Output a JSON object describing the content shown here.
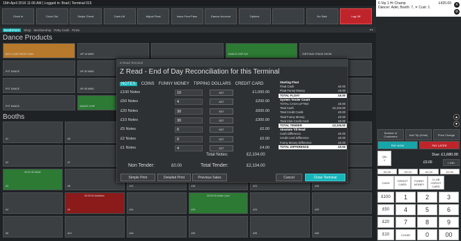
{
  "status": {
    "text": "15th April 2016 11:06 AM | Logged in: Brad | Terminal 015"
  },
  "topbar": [
    "Clock In",
    "Clock Out",
    "Swipe Check",
    "Cash Lift",
    "Adjust Float",
    "Issue Free Pass",
    "Dancer Account",
    "Options",
    "",
    "No Sale",
    "Log Off"
  ],
  "tabs": [
    "BoothPoint",
    "Shop",
    "Membership",
    "Petty Cash",
    "Fines"
  ],
  "tab_arrows": "◂ ▸",
  "sections": {
    "dance": "Dance Products",
    "booths": "Booths"
  },
  "dance_tiles": [
    {
      "label": "BUY CLUB CREDIT £460",
      "style": "orange"
    },
    {
      "label": "VIP 15 MINS",
      "style": ""
    },
    {
      "label": "",
      "style": ""
    },
    {
      "label": "DANCE CHIP £20",
      "style": "green"
    },
    {
      "label": "BIRTHDAY STAGE SHOW",
      "style": ""
    },
    {
      "label": "PVT DANCE",
      "style": ""
    },
    {
      "label": "VIP 30 MINS",
      "style": ""
    },
    {
      "label": "",
      "style": ""
    },
    {
      "label": "",
      "style": ""
    },
    {
      "label": "",
      "style": ""
    },
    {
      "label": "PVT DANCE",
      "style": ""
    },
    {
      "label": "VIP 45 MINS",
      "style": ""
    },
    {
      "label": "",
      "style": ""
    },
    {
      "label": "",
      "style": ""
    },
    {
      "label": "",
      "style": ""
    },
    {
      "label": "PVT DANCE",
      "style": ""
    },
    {
      "label": "DANCE CHIP",
      "style": "green"
    },
    {
      "label": "",
      "style": ""
    },
    {
      "label": "",
      "style": ""
    },
    {
      "label": "",
      "style": ""
    }
  ],
  "booth_tiles": [
    {
      "label": "#1",
      "style": "",
      "top": ""
    },
    {
      "label": "#6",
      "style": "",
      "top": ""
    },
    {
      "label": "#11",
      "style": "",
      "top": ""
    },
    {
      "label": "#16",
      "style": "",
      "top": ""
    },
    {
      "label": "#21",
      "style": "",
      "top": ""
    },
    {
      "label": "#26",
      "style": "",
      "top": ""
    },
    {
      "label": "#2",
      "style": "",
      "top": ""
    },
    {
      "label": "#7",
      "style": "",
      "top": ""
    },
    {
      "label": "#12",
      "style": "",
      "top": ""
    },
    {
      "label": "#17",
      "style": "",
      "top": ""
    },
    {
      "label": "#22",
      "style": "",
      "top": ""
    },
    {
      "label": "#27",
      "style": "",
      "top": ""
    },
    {
      "label": "#3",
      "style": "green",
      "top": "00:01:32 Abbie"
    },
    {
      "label": "#8",
      "style": "",
      "top": ""
    },
    {
      "label": "#13",
      "style": "",
      "top": ""
    },
    {
      "label": "#18",
      "style": "",
      "top": ""
    },
    {
      "label": "#23",
      "style": "",
      "top": ""
    },
    {
      "label": "#28",
      "style": "",
      "top": ""
    },
    {
      "label": "#4",
      "style": "",
      "top": ""
    },
    {
      "label": "#9",
      "style": "red",
      "top": "00:00:00 Addiction"
    },
    {
      "label": "#14",
      "style": "",
      "top": ""
    },
    {
      "label": "#19",
      "style": "green",
      "top": "00:00:20 Action Lynn"
    },
    {
      "label": "#24",
      "style": "",
      "top": ""
    },
    {
      "label": "#29",
      "style": "",
      "top": ""
    },
    {
      "label": "#5",
      "style": "",
      "top": ""
    },
    {
      "label": "#10",
      "style": "",
      "top": ""
    },
    {
      "label": "#15",
      "style": "",
      "top": ""
    },
    {
      "label": "#20",
      "style": "",
      "top": ""
    },
    {
      "label": "#25",
      "style": "",
      "top": ""
    },
    {
      "label": "#30",
      "style": "",
      "top": ""
    }
  ],
  "modal": {
    "window_title": "Z Read Terminal",
    "title": "Z Read - End of Day Reconciliation for this Terminal",
    "tabs": [
      "NOTES",
      "COINS",
      "FUNNY MONEY",
      "TIPPING DOLLARS",
      "CREDIT CARD"
    ],
    "rows": [
      {
        "name": "£100 Notes",
        "qty": "10",
        "set": "SET",
        "value": "£1,000.00"
      },
      {
        "name": "£50 Notes",
        "qty": "4",
        "set": "SET",
        "value": "£200.00"
      },
      {
        "name": "£20 Notes",
        "qty": "30",
        "set": "SET",
        "value": "£600.00"
      },
      {
        "name": "£10 Notes",
        "qty": "30",
        "set": "SET",
        "value": "£300.00"
      },
      {
        "name": "£5 Notes",
        "qty": "0",
        "set": "SET",
        "value": "£0.00"
      },
      {
        "name": "£2 Notes",
        "qty": "0",
        "set": "SET",
        "value": "£0.00"
      },
      {
        "name": "£1 Notes",
        "qty": "4",
        "set": "SET",
        "value": "£4.00"
      }
    ],
    "total_notes_label": "Total Notes:",
    "total_notes": "£2,104.00",
    "non_tender_label": "Non Tender:",
    "non_tender": "£0.00",
    "total_tender_label": "Total Tender:",
    "total_tender": "£2,104.00",
    "summary": [
      {
        "k": "Starting Float",
        "v": "",
        "cls": "head"
      },
      {
        "k": "Float Cash",
        "v": "£0.00",
        "cls": ""
      },
      {
        "k": "Float Funny Money",
        "v": "£0.00",
        "cls": ""
      },
      {
        "k": "TOTAL FLOAT",
        "v": "£0.00",
        "cls": "tot"
      },
      {
        "k": "System Tender Count",
        "v": "",
        "cls": "head"
      },
      {
        "k": "TOTAL CASH LIFTED",
        "v": "£0.00",
        "cls": ""
      },
      {
        "k": "Total Cash",
        "v": "£2,104.00",
        "cls": ""
      },
      {
        "k": "Total Credit Cards",
        "v": "£0.00",
        "cls": ""
      },
      {
        "k": "Total Funny Money",
        "v": "£0.00",
        "cls": ""
      },
      {
        "k": "Total Club Credit Card",
        "v": "£0.00",
        "cls": ""
      },
      {
        "k": "TOTAL TENDER",
        "v": "£2,104.00",
        "cls": "tot"
      },
      {
        "k": "Absolute Till Read",
        "v": "",
        "cls": "head"
      },
      {
        "k": "Cash Difference",
        "v": "£0.00",
        "cls": ""
      },
      {
        "k": "Credit Card Difference",
        "v": "£0.00",
        "cls": ""
      },
      {
        "k": "Funny Money Difference",
        "v": "£0.00",
        "cls": ""
      },
      {
        "k": "TOTAL DIFFERENCE",
        "v": "£0.00",
        "cls": "tot"
      }
    ],
    "buttons": {
      "simple": "Simple Print",
      "detailed": "Detailed Print",
      "previous": "Previous Sales",
      "cancel": "Cancel",
      "close": "Close Terminal"
    }
  },
  "right": {
    "header_line1": "6    Vip 1 Hr Champ",
    "header_line2": "Dancer: Adel, Booth: 7, ✕ Cust: 1",
    "header_amount": "£420.00",
    "buttons": {
      "num_customers": "Number of Customers",
      "add_tip": "Add Tip (Drink)",
      "price_change": "Price Change",
      "pay_now": "PAY NOW",
      "pay_later": "PAY LATER",
      "qty": "Qty",
      "qty_val": "1",
      "del": "« DEL",
      "cash": "CASH",
      "credit": "CREDIT CARD",
      "funny": "FUNNY MONEY",
      "club": "CLUB CREDIT CARD",
      "clear": "CLEAR"
    },
    "due": "Due: £1,680.00",
    "zero": "£0.00",
    "quick": [
      "£100",
      "£50",
      "£20",
      "£10"
    ],
    "coins": [
      "£0.05",
      "£0.10",
      "£0.20",
      "£0.50"
    ],
    "keys": [
      "1",
      "2",
      "3",
      "4",
      "5",
      "6",
      "7",
      "8",
      "9",
      "0",
      "00"
    ]
  }
}
